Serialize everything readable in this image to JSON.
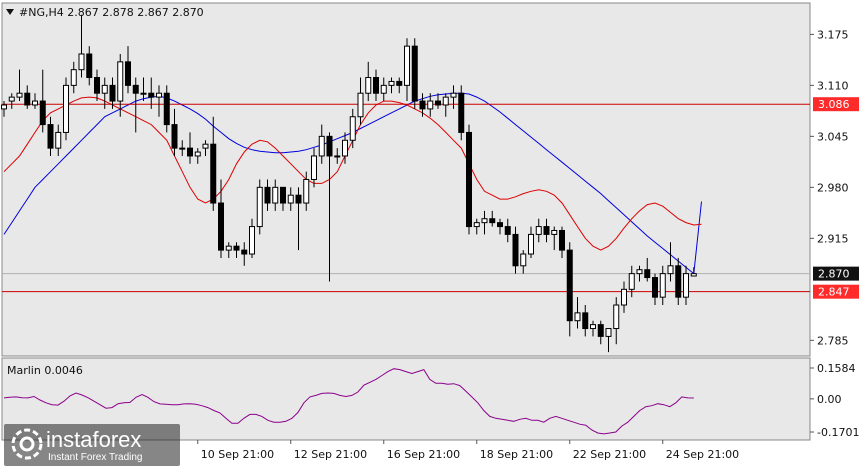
{
  "header": {
    "symbol_line": "#NG,H4  2.867 2.878 2.867 2.870",
    "menu_icon": "triangle-down-icon"
  },
  "indicator": {
    "label": "Marlin 0.0046",
    "ticks": [
      0.1584,
      0.0,
      -0.1701
    ],
    "tick_labels": [
      "0.1584",
      "0.00",
      "-0.1701"
    ],
    "color": "#8b008b",
    "values": [
      0.005,
      0.008,
      0.01,
      0.006,
      0.005,
      0.012,
      -0.006,
      -0.02,
      -0.03,
      -0.032,
      -0.012,
      0.015,
      0.03,
      0.02,
      0.006,
      -0.012,
      -0.03,
      -0.048,
      -0.045,
      -0.025,
      -0.02,
      -0.018,
      0.008,
      0.022,
      0.008,
      -0.014,
      -0.026,
      -0.028,
      -0.03,
      -0.03,
      -0.026,
      -0.025,
      -0.028,
      -0.035,
      -0.045,
      -0.06,
      -0.072,
      -0.1,
      -0.125,
      -0.125,
      -0.1,
      -0.08,
      -0.08,
      -0.09,
      -0.11,
      -0.12,
      -0.12,
      -0.115,
      -0.1,
      -0.07,
      -0.02,
      0.01,
      0.018,
      0.028,
      0.03,
      0.028,
      0.018,
      0.012,
      0.018,
      0.035,
      0.07,
      0.085,
      0.1,
      0.12,
      0.14,
      0.155,
      0.15,
      0.14,
      0.13,
      0.14,
      0.15,
      0.1,
      0.08,
      0.08,
      0.075,
      0.078,
      0.068,
      0.04,
      0.01,
      -0.02,
      -0.06,
      -0.09,
      -0.1,
      -0.105,
      -0.11,
      -0.115,
      -0.105,
      -0.1,
      -0.11,
      -0.11,
      -0.12,
      -0.1,
      -0.09,
      -0.1,
      -0.11,
      -0.12,
      -0.13,
      -0.135,
      -0.16,
      -0.175,
      -0.18,
      -0.175,
      -0.17,
      -0.14,
      -0.12,
      -0.09,
      -0.06,
      -0.04,
      -0.035,
      -0.025,
      -0.03,
      -0.04,
      -0.02,
      0.01,
      0.005,
      0.0046
    ]
  },
  "chart_data": {
    "type": "candlestick",
    "symbol": "#NG",
    "timeframe": "H4",
    "last": {
      "open": 2.867,
      "high": 2.878,
      "low": 2.867,
      "close": 2.87
    },
    "y_ticks": [
      3.175,
      3.11,
      3.045,
      2.98,
      2.915,
      2.785
    ],
    "y_tick_labels": [
      "3.175",
      "3.110",
      "3.045",
      "2.980",
      "2.915",
      "2.785"
    ],
    "ylim": [
      2.765,
      3.215
    ],
    "x_labels": [
      {
        "index": 25,
        "text": "10 Sep 21:00"
      },
      {
        "index": 37,
        "text": "12 Sep 21:00"
      },
      {
        "index": 49,
        "text": "16 Sep 21:00"
      },
      {
        "index": 61,
        "text": "18 Sep 21:00"
      },
      {
        "index": 73,
        "text": "22 Sep 21:00"
      },
      {
        "index": 85,
        "text": "24 Sep 21:00"
      }
    ],
    "price_tags": [
      {
        "value": 3.086,
        "label": "3.086",
        "bg": "#ff2a2a",
        "fg": "#ffffff"
      },
      {
        "value": 2.87,
        "label": "2.870",
        "bg": "#111111",
        "fg": "#ffffff"
      },
      {
        "value": 2.847,
        "label": "2.847",
        "bg": "#ff2a2a",
        "fg": "#ffffff"
      }
    ],
    "levels": [
      {
        "value": 3.086,
        "color": "#cc0000"
      },
      {
        "value": 2.847,
        "color": "#cc0000"
      }
    ],
    "current_price_line": {
      "value": 2.87,
      "color": "#b0b0b0"
    },
    "colors": {
      "background": "#e8e8e8",
      "bull": "#ffffff",
      "bear": "#000000",
      "ma_slow": "#0000dd",
      "ma_fast": "#dd0000"
    },
    "candles": [
      [
        3.08,
        3.09,
        3.07,
        3.085
      ],
      [
        3.09,
        3.1,
        3.08,
        3.095
      ],
      [
        3.095,
        3.13,
        3.09,
        3.1
      ],
      [
        3.1,
        3.11,
        3.08,
        3.085
      ],
      [
        3.085,
        3.1,
        3.08,
        3.09
      ],
      [
        3.09,
        3.13,
        3.05,
        3.06
      ],
      [
        3.06,
        3.07,
        3.02,
        3.03
      ],
      [
        3.03,
        3.06,
        3.02,
        3.05
      ],
      [
        3.05,
        3.12,
        3.04,
        3.11
      ],
      [
        3.11,
        3.14,
        3.1,
        3.13
      ],
      [
        3.13,
        3.2,
        3.12,
        3.15
      ],
      [
        3.15,
        3.16,
        3.11,
        3.12
      ],
      [
        3.12,
        3.13,
        3.09,
        3.1
      ],
      [
        3.1,
        3.12,
        3.08,
        3.11
      ],
      [
        3.11,
        3.12,
        3.08,
        3.09
      ],
      [
        3.09,
        3.15,
        3.07,
        3.14
      ],
      [
        3.14,
        3.16,
        3.1,
        3.11
      ],
      [
        3.11,
        3.12,
        3.05,
        3.1
      ],
      [
        3.1,
        3.12,
        3.09,
        3.1
      ],
      [
        3.1,
        3.12,
        3.08,
        3.095
      ],
      [
        3.095,
        3.11,
        3.07,
        3.1
      ],
      [
        3.1,
        3.11,
        3.05,
        3.06
      ],
      [
        3.06,
        3.08,
        3.02,
        3.03
      ],
      [
        3.03,
        3.04,
        3.02,
        3.03
      ],
      [
        3.03,
        3.05,
        3.01,
        3.02
      ],
      [
        3.02,
        3.03,
        3.01,
        3.025
      ],
      [
        3.03,
        3.04,
        3.02,
        3.035
      ],
      [
        3.035,
        3.07,
        2.95,
        2.96
      ],
      [
        2.96,
        2.99,
        2.89,
        2.9
      ],
      [
        2.9,
        2.91,
        2.89,
        2.905
      ],
      [
        2.905,
        2.91,
        2.89,
        2.9
      ],
      [
        2.9,
        2.91,
        2.88,
        2.895
      ],
      [
        2.895,
        2.94,
        2.89,
        2.93
      ],
      [
        2.93,
        2.99,
        2.92,
        2.98
      ],
      [
        2.98,
        2.99,
        2.95,
        2.96
      ],
      [
        2.96,
        2.99,
        2.95,
        2.98
      ],
      [
        2.98,
        2.98,
        2.95,
        2.96
      ],
      [
        2.96,
        2.98,
        2.95,
        2.97
      ],
      [
        2.97,
        2.98,
        2.9,
        2.96
      ],
      [
        2.96,
        3.0,
        2.95,
        2.99
      ],
      [
        2.99,
        3.03,
        2.98,
        3.02
      ],
      [
        3.02,
        3.06,
        3.01,
        3.045
      ],
      [
        3.045,
        3.05,
        2.86,
        3.02
      ],
      [
        3.02,
        3.03,
        3.01,
        3.02
      ],
      [
        3.02,
        3.05,
        3.01,
        3.04
      ],
      [
        3.04,
        3.08,
        3.03,
        3.07
      ],
      [
        3.07,
        3.12,
        3.06,
        3.1
      ],
      [
        3.1,
        3.14,
        3.09,
        3.12
      ],
      [
        3.12,
        3.13,
        3.09,
        3.1
      ],
      [
        3.1,
        3.12,
        3.09,
        3.11
      ],
      [
        3.11,
        3.12,
        3.1,
        3.115
      ],
      [
        3.115,
        3.12,
        3.1,
        3.11
      ],
      [
        3.11,
        3.17,
        3.09,
        3.16
      ],
      [
        3.16,
        3.17,
        3.08,
        3.09
      ],
      [
        3.09,
        3.1,
        3.07,
        3.08
      ],
      [
        3.08,
        3.1,
        3.07,
        3.09
      ],
      [
        3.09,
        3.1,
        3.08,
        3.085
      ],
      [
        3.085,
        3.1,
        3.07,
        3.095
      ],
      [
        3.095,
        3.11,
        3.08,
        3.1
      ],
      [
        3.1,
        3.11,
        3.04,
        3.05
      ],
      [
        3.05,
        3.06,
        2.92,
        2.93
      ],
      [
        2.93,
        2.94,
        2.92,
        2.935
      ],
      [
        2.935,
        2.95,
        2.92,
        2.94
      ],
      [
        2.94,
        2.95,
        2.93,
        2.935
      ],
      [
        2.935,
        2.94,
        2.92,
        2.93
      ],
      [
        2.93,
        2.94,
        2.91,
        2.92
      ],
      [
        2.92,
        2.93,
        2.87,
        2.88
      ],
      [
        2.88,
        2.9,
        2.87,
        2.895
      ],
      [
        2.895,
        2.93,
        2.89,
        2.92
      ],
      [
        2.92,
        2.94,
        2.91,
        2.93
      ],
      [
        2.93,
        2.94,
        2.91,
        2.92
      ],
      [
        2.92,
        2.93,
        2.9,
        2.925
      ],
      [
        2.925,
        2.93,
        2.89,
        2.9
      ],
      [
        2.9,
        2.91,
        2.79,
        2.81
      ],
      [
        2.81,
        2.84,
        2.8,
        2.82
      ],
      [
        2.82,
        2.83,
        2.79,
        2.8
      ],
      [
        2.8,
        2.81,
        2.79,
        2.805
      ],
      [
        2.805,
        2.81,
        2.78,
        2.79
      ],
      [
        2.79,
        2.8,
        2.77,
        2.8
      ],
      [
        2.8,
        2.84,
        2.78,
        2.83
      ],
      [
        2.83,
        2.86,
        2.82,
        2.85
      ],
      [
        2.85,
        2.88,
        2.84,
        2.87
      ],
      [
        2.87,
        2.88,
        2.86,
        2.875
      ],
      [
        2.875,
        2.89,
        2.86,
        2.865
      ],
      [
        2.865,
        2.87,
        2.83,
        2.84
      ],
      [
        2.84,
        2.88,
        2.83,
        2.87
      ],
      [
        2.87,
        2.91,
        2.86,
        2.88
      ],
      [
        2.88,
        2.89,
        2.83,
        2.84
      ],
      [
        2.84,
        2.88,
        2.83,
        2.87
      ],
      [
        2.867,
        2.878,
        2.867,
        2.87
      ]
    ],
    "ma_slow": [
      2.92,
      2.935,
      2.95,
      2.965,
      2.98,
      2.99,
      3.0,
      3.01,
      3.02,
      3.03,
      3.04,
      3.05,
      3.06,
      3.07,
      3.075,
      3.08,
      3.085,
      3.09,
      3.093,
      3.095,
      3.096,
      3.094,
      3.09,
      3.085,
      3.08,
      3.074,
      3.067,
      3.058,
      3.05,
      3.042,
      3.036,
      3.031,
      3.028,
      3.026,
      3.025,
      3.024,
      3.024,
      3.025,
      3.026,
      3.028,
      3.031,
      3.034,
      3.038,
      3.042,
      3.046,
      3.05,
      3.055,
      3.06,
      3.065,
      3.07,
      3.075,
      3.08,
      3.085,
      3.09,
      3.093,
      3.096,
      3.098,
      3.099,
      3.1,
      3.1,
      3.099,
      3.095,
      3.09,
      3.083,
      3.076,
      3.068,
      3.06,
      3.052,
      3.044,
      3.036,
      3.028,
      3.02,
      3.012,
      3.004,
      2.996,
      2.988,
      2.98,
      2.972,
      2.963,
      2.954,
      2.945,
      2.936,
      2.927,
      2.918,
      2.91,
      2.902,
      2.894,
      2.886,
      2.878,
      2.87,
      2.962
    ],
    "ma_fast": [
      3.0,
      3.01,
      3.02,
      3.035,
      3.05,
      3.065,
      3.075,
      3.08,
      3.085,
      3.09,
      3.094,
      3.095,
      3.094,
      3.09,
      3.085,
      3.08,
      3.075,
      3.07,
      3.065,
      3.06,
      3.05,
      3.04,
      3.02,
      3.0,
      2.98,
      2.965,
      2.96,
      2.965,
      2.975,
      2.99,
      3.01,
      3.025,
      3.035,
      3.04,
      3.038,
      3.03,
      3.02,
      3.01,
      3.0,
      2.99,
      2.985,
      2.985,
      2.99,
      3.0,
      3.02,
      3.04,
      3.06,
      3.075,
      3.085,
      3.09,
      3.09,
      3.088,
      3.085,
      3.08,
      3.075,
      3.068,
      3.06,
      3.05,
      3.04,
      3.03,
      3.01,
      2.99,
      2.975,
      2.97,
      2.965,
      2.965,
      2.968,
      2.972,
      2.975,
      2.977,
      2.975,
      2.97,
      2.96,
      2.945,
      2.93,
      2.915,
      2.905,
      2.9,
      2.905,
      2.915,
      2.928,
      2.94,
      2.95,
      2.958,
      2.96,
      2.956,
      2.948,
      2.94,
      2.935,
      2.932,
      2.933
    ]
  },
  "watermark": {
    "brand": "instaforex",
    "tagline": "Instant Forex Trading",
    "logo_icon": "instaforex-logo-icon"
  }
}
